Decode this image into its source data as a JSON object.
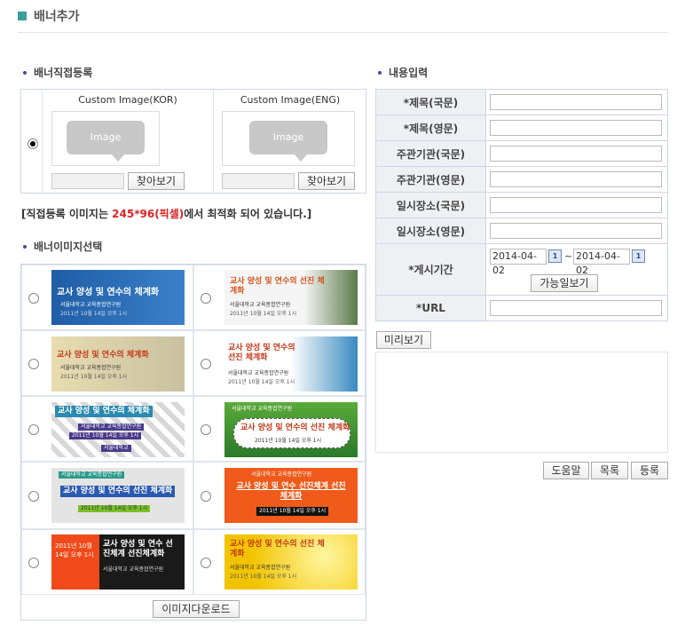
{
  "page": {
    "title": "배너추가"
  },
  "direct": {
    "heading": "배너직접등록",
    "kor": {
      "caption": "Custom Image(KOR)",
      "placeholder": "Image",
      "browse": "찾아보기"
    },
    "eng": {
      "caption": "Custom Image(ENG)",
      "placeholder": "Image",
      "browse": "찾아보기"
    },
    "note_pre": "[직접등록 이미지는 ",
    "note_size": "245*96(픽셀)",
    "note_post": "에서 최적화 되어 있습니다.]"
  },
  "gallery": {
    "heading": "배너이미지선택",
    "download": "이미지다운로드",
    "banners": [
      {
        "title": "교사 양성 및 연수의 체계화",
        "org": "서울대학교 교육종합연구원",
        "date": "2011년 10월 14일 오후 1시",
        "colors": {
          "bg": "#2a6bb0",
          "text": "#ffffff"
        }
      },
      {
        "title": "교사 양성 및 연수의 선진 체계화",
        "org": "서울대학교 교육종합연구원",
        "date": "2011년 10월 14일 오후 1시",
        "colors": {
          "bg": "#f2f2f2",
          "text": "#d4561a"
        }
      },
      {
        "title": "교사 양성 및 연수의 체계화",
        "org": "서울대학교 교육종합연구원",
        "date": "2011년 10월 14일 오후 1시",
        "colors": {
          "bg": "#e8dcb0",
          "text": "#c43a1a"
        }
      },
      {
        "title": "교사 양성 및 연수의 선진 체계화",
        "org": "서울대학교 교육종합연구원",
        "date": "2011년 10월 14일 오후 1시",
        "colors": {
          "bg": "#ffffff",
          "text": "#c43a1a"
        }
      },
      {
        "title": "교사 양성 및 연수의 체계화",
        "org": "서울대학교 교육종합연구원",
        "date": "2011년 10월 14일 오후 1시",
        "colors": {
          "bg": "#d8e8f0",
          "text": "#ffffff"
        }
      },
      {
        "title": "교사 양성 및 연수의 선진 체계화",
        "org": "서울대학교 교육종합연구원",
        "date": "2011년 10월 14일 오후 1시",
        "colors": {
          "bg": "#4a9a3a",
          "text": "#c43a1a"
        }
      },
      {
        "title": "교사 양성 및 연수의 선진 체계화",
        "org": "서울대학교 교육종합연구원",
        "date": "2011년 10월 14일 오후 1시",
        "colors": {
          "bg": "#e0e0e0",
          "text": "#ffffff"
        }
      },
      {
        "title": "교사 양성 및 연수 선진체계 선진체계화",
        "org": "서울대학교 교육종합연구원",
        "date": "2011년 10월 14일 오후 1시",
        "colors": {
          "bg": "#f05a1a",
          "text": "#ffffff"
        }
      },
      {
        "title": "교사 양성 및 연수 선진체계 선진체계화",
        "org": "서울대학교 교육종합연구원",
        "date": "2011년 10월 14일 오후 1시",
        "colors": {
          "bg": "#1a1a1a",
          "text": "#ffffff"
        }
      },
      {
        "title": "교사 양성 및 연수의 선진 체계화",
        "org": "서울대학교 교육종합연구원",
        "date": "2011년 10월 14일 오후 1시",
        "colors": {
          "bg": "#f5d020",
          "text": "#c43a1a"
        }
      }
    ],
    "banner_extra": {
      "b5_tag": "서울대학교",
      "b9_date": "2011년 10월 14일 오후 1시"
    }
  },
  "content": {
    "heading": "내용입력",
    "labels": {
      "title_kor": "*제목(국문)",
      "title_eng": "*제목(영문)",
      "host_kor": "주관기관(국문)",
      "host_eng": "주관기관(영문)",
      "venue_kor": "일시장소(국문)",
      "venue_eng": "일시장소(영문)",
      "period": "*게시기간",
      "url": "*URL"
    },
    "date_from": "2014-04-02",
    "date_to": "2014-04-02",
    "tilde": "~",
    "availability": "가능일보기",
    "preview": "미리보기",
    "help": "도움말",
    "list": "목록",
    "register": "등록"
  }
}
